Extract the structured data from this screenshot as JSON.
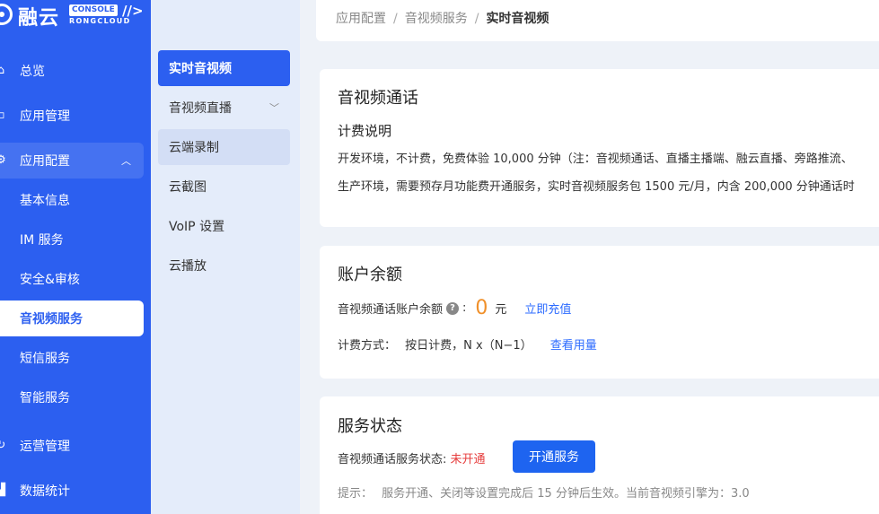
{
  "logo": {
    "name": "融云",
    "badge": "CONSOLE",
    "slash": "//>",
    "sub": "RONGCLOUD"
  },
  "sidebar": {
    "items": [
      {
        "label": "总览",
        "icon": "home-icon"
      },
      {
        "label": "应用管理",
        "icon": "app-icon"
      },
      {
        "label": "应用配置",
        "icon": "config-icon"
      },
      {
        "label": "基本信息"
      },
      {
        "label": "IM 服务"
      },
      {
        "label": "安全&审核"
      },
      {
        "label": "音视频服务"
      },
      {
        "label": "短信服务"
      },
      {
        "label": "智能服务"
      },
      {
        "label": "运营管理",
        "icon": "operations-icon"
      },
      {
        "label": "数据统计",
        "icon": "stats-icon"
      }
    ]
  },
  "submenu": {
    "items": [
      {
        "label": "实时音视频"
      },
      {
        "label": "音视频直播"
      },
      {
        "label": "云端录制"
      },
      {
        "label": "云截图"
      },
      {
        "label": "VoIP 设置"
      },
      {
        "label": "云播放"
      }
    ]
  },
  "breadcrumb": {
    "items": [
      "应用配置",
      "音视频服务",
      "实时音视频"
    ],
    "sep": "/"
  },
  "billing": {
    "title": "音视频通话",
    "subtitle": "计费说明",
    "line1": "开发环境，不计费，免费体验 10,000 分钟（注：音视频通话、直播主播端、融云直播、旁路推流、",
    "line2": "生产环境，需要预存月功能费开通服务，实时音视频服务包 1500 元/月，内含 200,000 分钟通话时"
  },
  "balance": {
    "title": "账户余额",
    "label": "音视频通话账户余额",
    "colon": ":",
    "value": "0",
    "unit": "元",
    "recharge": "立即充值",
    "method_label": "计费方式：",
    "method_value": "按日计费，N x（N−1）",
    "usage_link": "查看用量"
  },
  "service": {
    "title": "服务状态",
    "label": "音视频通话服务状态:",
    "status": "未开通",
    "button": "开通服务",
    "hint_label": "提示：",
    "hint": "服务开通、关闭等设置完成后 15 分钟后生效。当前音视频引擎为：3.0"
  }
}
